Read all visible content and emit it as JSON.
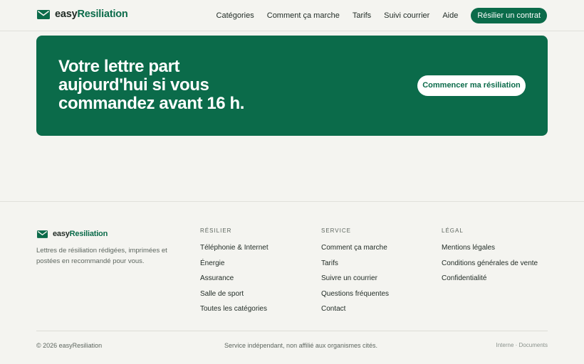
{
  "brand": {
    "part1": "easy",
    "part2": "Resiliation",
    "color": "#0b6b4a"
  },
  "nav": {
    "items": [
      "Catégories",
      "Comment ça marche",
      "Tarifs",
      "Suivi courrier",
      "Aide"
    ],
    "cta": "Résilier un contrat"
  },
  "hero": {
    "title": "Votre lettre part aujourd'hui si vous commandez avant 16 h.",
    "button": "Commencer ma résiliation"
  },
  "footer": {
    "description": "Lettres de résiliation rédigées, imprimées et postées en recommandé pour vous.",
    "columns": [
      {
        "heading": "RÉSILIER",
        "links": [
          "Téléphonie & Internet",
          "Énergie",
          "Assurance",
          "Salle de sport",
          "Toutes les catégories"
        ]
      },
      {
        "heading": "SERVICE",
        "links": [
          "Comment ça marche",
          "Tarifs",
          "Suivre un courrier",
          "Questions fréquentes",
          "Contact"
        ]
      },
      {
        "heading": "LÉGAL",
        "links": [
          "Mentions légales",
          "Conditions générales de vente",
          "Confidentialité"
        ]
      }
    ],
    "copyright": "© 2026 easyResiliation",
    "disclaimer": "Service indépendant, non affilié aux organismes cités.",
    "small_links": [
      "Interne",
      "Documents"
    ],
    "small_sep": "·"
  }
}
